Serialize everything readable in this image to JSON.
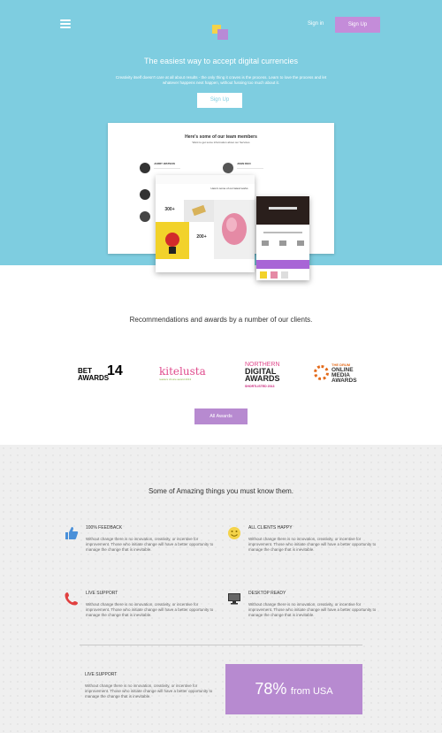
{
  "header": {
    "menu_icon": "hamburger-icon",
    "signin_label": "Sign in",
    "signup_label": "Sign Up"
  },
  "hero": {
    "title": "The easiest way to accept digital currencies",
    "subtitle": "Creativity itself doesn't care at all about results - the only thing it craves is the process. Learn to love the process and let whatever happens next happen, without fussing too much about it.",
    "button_label": "Sign Up",
    "mockup": {
      "title": "Here's some of our team members",
      "subtitle": "Want to get some information about our Services",
      "members": [
        {
          "name": "JARRY WATSON"
        },
        {
          "name": "JOHN DEO"
        }
      ],
      "card_text": "Here's some of our latest works",
      "stat1": "300+",
      "stat2": "200+"
    }
  },
  "awards": {
    "title": "Recommendations and awards by a number of our clients.",
    "logos": [
      {
        "name": "bet-awards-logo",
        "line1": "BET",
        "line2": "AWARDS",
        "num": "14"
      },
      {
        "name": "kitelusta-logo",
        "text": "kitelusta",
        "tag": "readers choice award 2013"
      },
      {
        "name": "northern-digital-awards-logo",
        "line1": "NORTHERN",
        "line2": "DIGITAL",
        "line3": "AWARDS",
        "line4": "SHORTLISTED 2013"
      },
      {
        "name": "the-drum-logo",
        "line1": "THE DRUM",
        "line2": "ONLINE",
        "line3": "MEDIA",
        "line4": "AWARDS"
      }
    ],
    "button_label": "All Awards"
  },
  "features": {
    "title": "Some of Amazing things you must know them.",
    "items": [
      {
        "icon": "thumbs-up-icon",
        "heading": "100% FEEDBACK",
        "text": "Without change there is no innovation, creativity, or incentive for improvement. Those who initiate change will have a better opportunity to manage the change that is inevitable."
      },
      {
        "icon": "smiley-icon",
        "heading": "ALL CLIENTS HAPPY",
        "text": "Without change there is no innovation, creativity, or incentive for improvement. Those who initiate change will have a better opportunity to manage the change that is inevitable."
      },
      {
        "icon": "phone-icon",
        "heading": "LIVE SUPPORT",
        "text": "Without change there is no innovation, creativity, or incentive for improvement. Those who initiate change will have a better opportunity to manage the change that is inevitable."
      },
      {
        "icon": "monitor-icon",
        "heading": "DESKTOP READY",
        "text": "Without change there is no innovation, creativity, or incentive for improvement. Those who initiate change will have a better opportunity to manage the change that is inevitable."
      },
      {
        "heading": "LIVE SUPPORT",
        "text": "Without change there is no innovation, creativity, or incentive for improvement. Those who initiate change will have a better opportunity to manage the change that is inevitable."
      }
    ],
    "stat": {
      "value": "78%",
      "label": "from USA"
    }
  },
  "colors": {
    "hero_bg": "#7ecde0",
    "accent_purple": "#b78ad0",
    "logo_yellow": "#f4d34a"
  }
}
